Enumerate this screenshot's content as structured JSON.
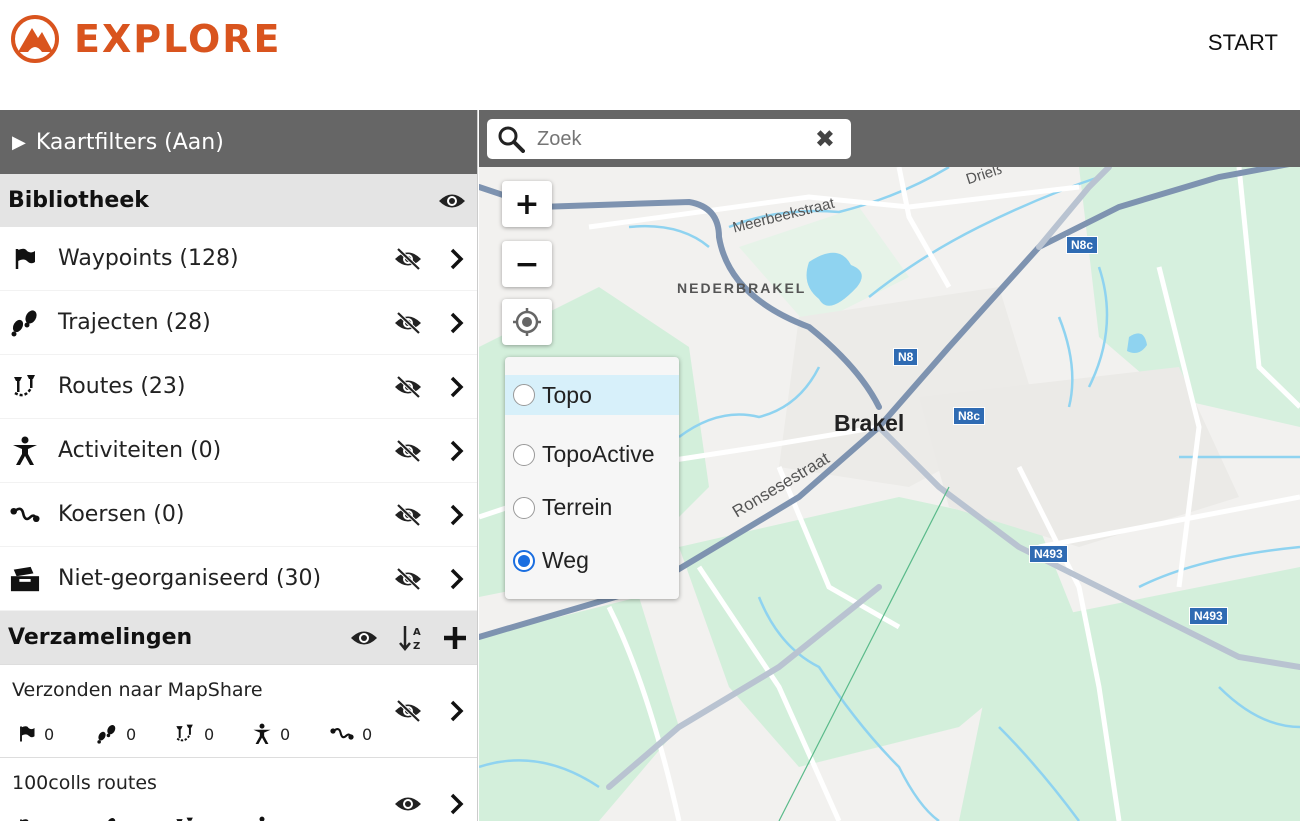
{
  "header": {
    "brand": "EXPLORE",
    "start_label": "START"
  },
  "sidebar": {
    "filter_label": "Kaartfilters (Aan)",
    "library": {
      "title": "Bibliotheek",
      "items": [
        {
          "icon": "flag-icon",
          "label": "Waypoints (128)"
        },
        {
          "icon": "footprints-icon",
          "label": "Trajecten (28)"
        },
        {
          "icon": "route-pins-icon",
          "label": "Routes (23)"
        },
        {
          "icon": "activity-person-icon",
          "label": "Activiteiten (0)"
        },
        {
          "icon": "course-squiggle-icon",
          "label": "Koersen (0)"
        },
        {
          "icon": "unorganized-box-icon",
          "label": "Niet-georganiseerd (30)"
        }
      ]
    },
    "collections": {
      "title": "Verzamelingen",
      "items": [
        {
          "title": "Verzonden naar MapShare",
          "counts": [
            "0",
            "0",
            "0",
            "0",
            "0"
          ]
        },
        {
          "title": "100colls routes",
          "counts": [
            "",
            "",
            "",
            "",
            ""
          ]
        }
      ]
    }
  },
  "map": {
    "search_placeholder": "Zoek",
    "zoom_in": "+",
    "zoom_out": "−",
    "layers": [
      {
        "label": "Topo",
        "selected": false
      },
      {
        "label": "TopoActive",
        "selected": false
      },
      {
        "label": "Terrein",
        "selected": false
      },
      {
        "label": "Weg",
        "selected": true
      }
    ],
    "labels": {
      "town": "Brakel",
      "district": "NEDERBRAKEL",
      "street1": "Meerbeekstraat",
      "street2": "Ronsesestraat",
      "street3": "Drieß"
    },
    "shields": [
      "N8c",
      "N8",
      "N8c",
      "N493",
      "N493"
    ],
    "colors": {
      "brand": "#d9541e",
      "water": "#8fd3f0",
      "green": "#cdeedd",
      "road": "#7e93b0"
    }
  }
}
